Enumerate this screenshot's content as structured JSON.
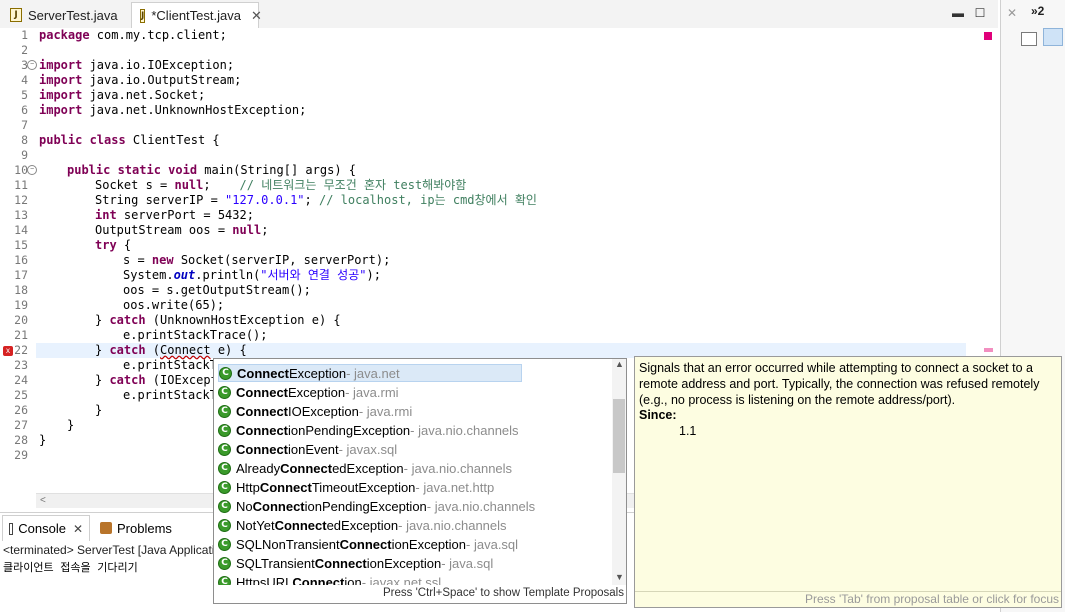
{
  "tabs": [
    {
      "label": "ServerTest.java"
    },
    {
      "label": "*ClientTest.java"
    }
  ],
  "right_panel": {
    "tab_label": "»2"
  },
  "gutter": [
    "1",
    "2",
    "3",
    "4",
    "5",
    "6",
    "7",
    "8",
    "9",
    "10",
    "11",
    "12",
    "13",
    "14",
    "15",
    "16",
    "17",
    "18",
    "19",
    "20",
    "21",
    "22",
    "23",
    "24",
    "25",
    "26",
    "27",
    "28",
    "29"
  ],
  "code": {
    "l1_kw": "package",
    "l1_rest": " com.my.tcp.client;",
    "l3_kw": "import",
    "l3_rest": " java.io.IOException;",
    "l4_kw": "import",
    "l4_rest": " java.io.OutputStream;",
    "l5_kw": "import",
    "l5_rest": " java.net.Socket;",
    "l6_kw": "import",
    "l6_rest": " java.net.UnknownHostException;",
    "l8_kw": "public class",
    "l8_rest": " ClientTest {",
    "l10_kw": "public static void",
    "l10_rest": " main(String[] args) {",
    "l11_a": "Socket s = ",
    "l11_kw": "null",
    "l11_b": ";    ",
    "l11_cmt": "// 네트워크는 무조건 혼자 test해봐야함",
    "l12_a": "String serverIP = ",
    "l12_str": "\"127.0.0.1\"",
    "l12_b": "; ",
    "l12_cmt": "// localhost, ip는 cmd창에서 확인",
    "l13_kw": "int",
    "l13_rest": " serverPort = 5432;",
    "l14_a": "OutputStream oos = ",
    "l14_kw": "null",
    "l14_b": ";",
    "l15_kw": "try",
    "l15_rest": " {",
    "l16_a": "s = ",
    "l16_kw": "new",
    "l16_b": " Socket(serverIP, serverPort);",
    "l17_a": "System.",
    "l17_fld": "out",
    "l17_b": ".println(",
    "l17_str": "\"서버와 연결 성공\"",
    "l17_c": ");",
    "l18": "oos = s.getOutputStream();",
    "l19": "oos.write(65);",
    "l20_a": "} ",
    "l20_kw": "catch",
    "l20_b": " (UnknownHostException e) {",
    "l21": "e.printStackTrace();",
    "l22_a": "} ",
    "l22_kw": "catch",
    "l22_b": " (",
    "l22_err": "Connect",
    "l22_c": " e) {",
    "l23": "e.printStackT",
    "l24_a": "} ",
    "l24_kw": "catch",
    "l24_b": " (IOExcept",
    "l25": "e.printStackT",
    "l26": "}",
    "l27": "}",
    "l28": "}"
  },
  "console": {
    "tab_label": "Console",
    "problems_label": "Problems",
    "terminated_text": "<terminated> ServerTest [Java Applicati",
    "output_text": "클라이언트 접속을 기다리기"
  },
  "proposals": [
    {
      "match": "Connect",
      "rest": "Exception",
      "pkg": " - java.net"
    },
    {
      "match": "Connect",
      "rest": "Exception",
      "pkg": " - java.rmi"
    },
    {
      "match": "Connect",
      "rest": "IOException",
      "pkg": " - java.rmi"
    },
    {
      "match": "Connect",
      "rest": "ionPendingException",
      "pkg": " - java.nio.channels"
    },
    {
      "match": "Connect",
      "rest": "ionEvent",
      "pkg": " - javax.sql"
    },
    {
      "pre": "Already",
      "match": "Connect",
      "rest": "edException",
      "pkg": " - java.nio.channels"
    },
    {
      "pre": "Http",
      "match": "Connect",
      "rest": "TimeoutException",
      "pkg": " - java.net.http"
    },
    {
      "pre": "No",
      "match": "Connect",
      "rest": "ionPendingException",
      "pkg": " - java.nio.channels"
    },
    {
      "pre": "NotYet",
      "match": "Connect",
      "rest": "edException",
      "pkg": " - java.nio.channels"
    },
    {
      "pre": "SQLNonTransient",
      "match": "Connect",
      "rest": "ionException",
      "pkg": " - java.sql"
    },
    {
      "pre": "SQLTransient",
      "match": "Connect",
      "rest": "ionException",
      "pkg": " - java.sql"
    },
    {
      "pre": "HttpsURL",
      "match": "Connect",
      "rest": "ion",
      "pkg": " - javax.net.ssl"
    }
  ],
  "proposal_footer": "Press 'Ctrl+Space' to show Template Proposals",
  "info": {
    "description": "Signals that an error occurred while attempting to connect a socket to a remote address and port. Typically, the connection was refused remotely (e.g., no process is listening on the remote address/port).",
    "since_label": "Since:",
    "since_value": "1.1",
    "footer": "Press 'Tab' from proposal table or click for focus"
  }
}
